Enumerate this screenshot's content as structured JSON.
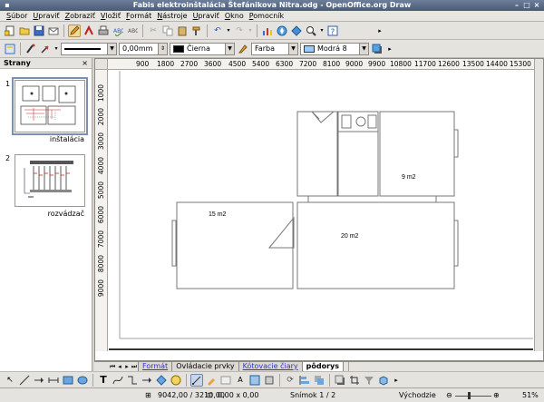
{
  "window": {
    "title": "Fabis elektroinštalácia Štefánikova Nitra.odg - OpenOffice.org Draw"
  },
  "menu": [
    "Súbor",
    "Upraviť",
    "Zobraziť",
    "Vložiť",
    "Formát",
    "Nástroje",
    "Upraviť",
    "Okno",
    "Pomocník"
  ],
  "line_toolbar": {
    "line_width": "0,00mm",
    "line_color": "Čierna",
    "area_style": "Farba",
    "area_color": "Modrá 8",
    "colors": {
      "line": "#000000",
      "area": "#99ccff"
    }
  },
  "pages_panel": {
    "title": "Strany",
    "close": "×",
    "pages": [
      {
        "number": "1",
        "name": "inštalácia"
      },
      {
        "number": "2",
        "name": "rozvádzač"
      }
    ]
  },
  "ruler_top": [
    "900",
    "1800",
    "2700",
    "3600",
    "4500",
    "5400",
    "6300",
    "7200",
    "8100",
    "9000",
    "9900",
    "10800",
    "11700",
    "12600",
    "13500",
    "14400",
    "15300"
  ],
  "ruler_left": [
    "1000",
    "2000",
    "3000",
    "4000",
    "5000",
    "6000",
    "7000",
    "8000",
    "9000"
  ],
  "rooms": {
    "r1": "9 m2",
    "r2": "15 m2",
    "r3": "20 m2"
  },
  "layer_tabs": [
    {
      "label": "Formát",
      "active": false
    },
    {
      "label": "Ovládacie prvky",
      "active": false
    },
    {
      "label": "Kótovacie čiary",
      "active": false
    },
    {
      "label": "pôdorys",
      "active": true
    }
  ],
  "status": {
    "position": "9042,00 / 3210,00",
    "size": "0,00 x 0,00",
    "slide": "Snímok 1 / 2",
    "page_style": "Východzie",
    "zoom": "51%"
  }
}
